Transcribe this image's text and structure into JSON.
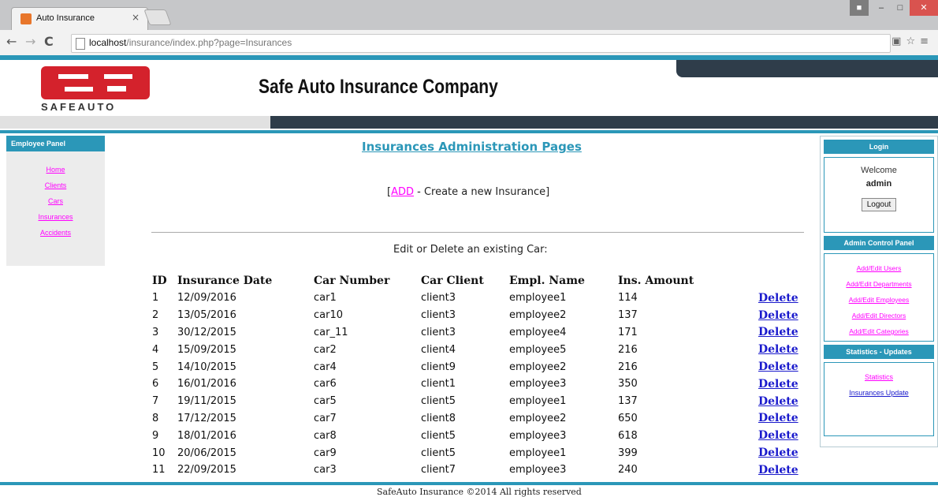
{
  "browser": {
    "tab_title": "Auto Insurance",
    "tab_close": "×",
    "url_host": "localhost",
    "url_path": "/insurance/index.php?page=Insurances"
  },
  "header": {
    "logo_text": "SAFEAUTO",
    "title": "Safe Auto Insurance Company"
  },
  "left_panel": {
    "title": "Employee Panel",
    "items": [
      "Home",
      "Clients",
      "Cars",
      "Insurances",
      "Accidents"
    ]
  },
  "main": {
    "title": "Insurances Administration Pages",
    "add_open": "[",
    "add_link": "ADD",
    "add_text": " - Create a new Insurance]",
    "subtitle": "Edit or Delete an existing Car:",
    "columns": [
      "ID",
      "Insurance Date",
      "Car Number",
      "Car Client",
      "Empl. Name",
      "Ins. Amount"
    ],
    "delete_label": "Delete",
    "rows": [
      [
        "1",
        "12/09/2016",
        "car1",
        "client3",
        "employee1",
        "114"
      ],
      [
        "2",
        "13/05/2016",
        "car10",
        "client3",
        "employee2",
        "137"
      ],
      [
        "3",
        "30/12/2015",
        "car_11",
        "client3",
        "employee4",
        "171"
      ],
      [
        "4",
        "15/09/2015",
        "car2",
        "client4",
        "employee5",
        "216"
      ],
      [
        "5",
        "14/10/2015",
        "car4",
        "client9",
        "employee2",
        "216"
      ],
      [
        "6",
        "16/01/2016",
        "car6",
        "client1",
        "employee3",
        "350"
      ],
      [
        "7",
        "19/11/2015",
        "car5",
        "client5",
        "employee1",
        "137"
      ],
      [
        "8",
        "17/12/2015",
        "car7",
        "client8",
        "employee2",
        "650"
      ],
      [
        "9",
        "18/01/2016",
        "car8",
        "client5",
        "employee3",
        "618"
      ],
      [
        "10",
        "20/06/2015",
        "car9",
        "client5",
        "employee1",
        "399"
      ],
      [
        "11",
        "22/09/2015",
        "car3",
        "client7",
        "employee3",
        "240"
      ]
    ]
  },
  "right_panel": {
    "login_title": "Login",
    "welcome": "Welcome",
    "username": "admin",
    "logout_label": "Logout",
    "admin_title": "Admin Control Panel",
    "admin_links": [
      "Add/Edit Users",
      "Add/Edit Departments",
      "Add/Edit Employees",
      "Add/Edit Directors",
      "Add/Edit Categories"
    ],
    "stats_title": "Statistics - Updates",
    "stats_links": [
      "Statistics",
      "Insurances Update"
    ]
  },
  "footer": {
    "text": "SafeAuto Insurance ©2014 All rights reserved"
  },
  "colors": {
    "accent": "#2b97b8",
    "dark": "#2f3d4a",
    "logo_red": "#d4222c",
    "link_magenta": "#ff00ff",
    "link_blue": "#1a1acc"
  }
}
